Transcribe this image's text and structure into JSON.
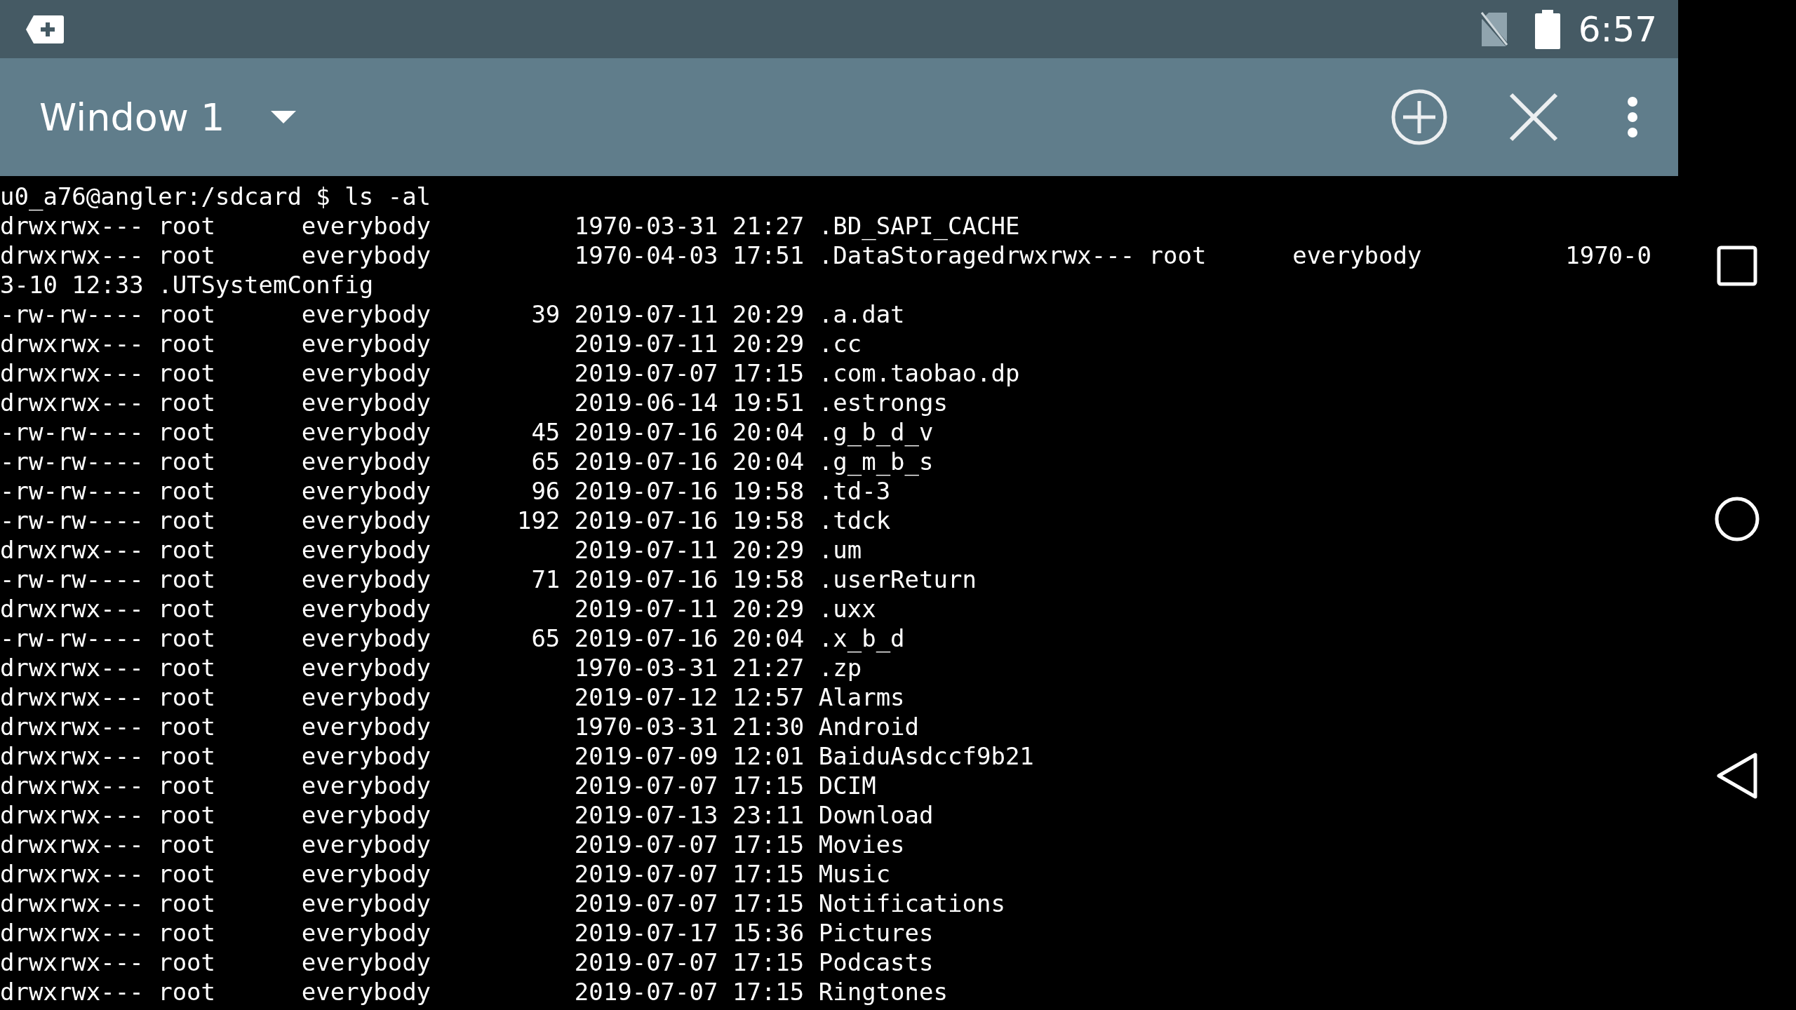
{
  "status_bar": {
    "time": "6:57"
  },
  "toolbar": {
    "title": "Window 1"
  },
  "terminal": {
    "lines": [
      "u0_a76@angler:/sdcard $ ls -al",
      "drwxrwx--- root      everybody          1970-03-31 21:27 .BD_SAPI_CACHE",
      "drwxrwx--- root      everybody          1970-04-03 17:51 .DataStoragedrwxrwx--- root      everybody          1970-0",
      "3-10 12:33 .UTSystemConfig",
      "-rw-rw---- root      everybody       39 2019-07-11 20:29 .a.dat",
      "drwxrwx--- root      everybody          2019-07-11 20:29 .cc",
      "drwxrwx--- root      everybody          2019-07-07 17:15 .com.taobao.dp",
      "drwxrwx--- root      everybody          2019-06-14 19:51 .estrongs",
      "-rw-rw---- root      everybody       45 2019-07-16 20:04 .g_b_d_v",
      "-rw-rw---- root      everybody       65 2019-07-16 20:04 .g_m_b_s",
      "-rw-rw---- root      everybody       96 2019-07-16 19:58 .td-3",
      "-rw-rw---- root      everybody      192 2019-07-16 19:58 .tdck",
      "drwxrwx--- root      everybody          2019-07-11 20:29 .um",
      "-rw-rw---- root      everybody       71 2019-07-16 19:58 .userReturn",
      "drwxrwx--- root      everybody          2019-07-11 20:29 .uxx",
      "-rw-rw---- root      everybody       65 2019-07-16 20:04 .x_b_d",
      "drwxrwx--- root      everybody          1970-03-31 21:27 .zp",
      "drwxrwx--- root      everybody          2019-07-12 12:57 Alarms",
      "drwxrwx--- root      everybody          1970-03-31 21:30 Android",
      "drwxrwx--- root      everybody          2019-07-09 12:01 BaiduAsdccf9b21",
      "drwxrwx--- root      everybody          2019-07-07 17:15 DCIM",
      "drwxrwx--- root      everybody          2019-07-13 23:11 Download",
      "drwxrwx--- root      everybody          2019-07-07 17:15 Movies",
      "drwxrwx--- root      everybody          2019-07-07 17:15 Music",
      "drwxrwx--- root      everybody          2019-07-07 17:15 Notifications",
      "drwxrwx--- root      everybody          2019-07-17 15:36 Pictures",
      "drwxrwx--- root      everybody          2019-07-07 17:15 Podcasts",
      "drwxrwx--- root      everybody          2019-07-07 17:15 Ringtones"
    ]
  }
}
